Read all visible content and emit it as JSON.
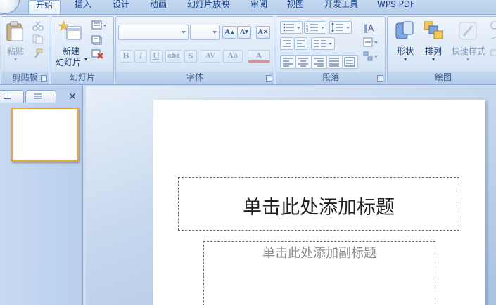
{
  "tabs": [
    {
      "label": "开始",
      "active": true
    },
    {
      "label": "插入"
    },
    {
      "label": "设计"
    },
    {
      "label": "动画"
    },
    {
      "label": "幻灯片放映"
    },
    {
      "label": "审阅"
    },
    {
      "label": "视图"
    },
    {
      "label": "开发工具"
    },
    {
      "label": "WPS PDF"
    }
  ],
  "ribbon": {
    "clipboard": {
      "label": "剪贴板",
      "paste": "粘贴"
    },
    "slides": {
      "label": "幻灯片",
      "new_slide_line1": "新建",
      "new_slide_line2": "幻灯片"
    },
    "font": {
      "label": "字体",
      "font_name": "",
      "font_size": "",
      "bold": "B",
      "italic": "I",
      "underline": "U",
      "strike": "abc",
      "shadow": "S",
      "spacing": "AV",
      "change_case": "Aa",
      "font_color": "A"
    },
    "paragraph": {
      "label": "段落"
    },
    "drawing": {
      "label": "绘图",
      "shapes": "形状",
      "arrange": "排列",
      "quick_styles": "快速样式"
    }
  },
  "slide": {
    "title_placeholder": "单击此处添加标题",
    "subtitle_placeholder": "单击此处添加副标题"
  },
  "colors": {
    "ribbon_text": "#15428b",
    "thumbnail_border": "#e8a64a",
    "accent": "#8fb0dc"
  }
}
